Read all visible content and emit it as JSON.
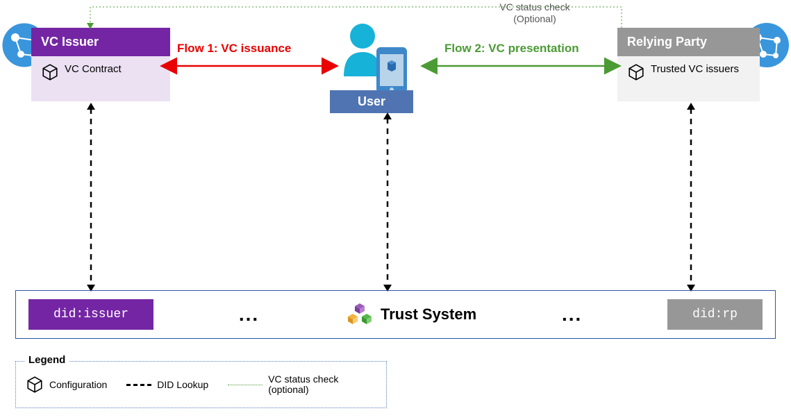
{
  "issuer": {
    "title": "VC Issuer",
    "contract": "VC Contract"
  },
  "rp": {
    "title": "Relying Party",
    "contract": "Trusted VC issuers"
  },
  "user": {
    "label": "User"
  },
  "flows": {
    "flow1": "Flow 1: VC  issuance",
    "flow2": "Flow 2: VC presentation"
  },
  "status_check": {
    "line1": "VC status check",
    "line2": "(Optional)"
  },
  "trust": {
    "did_issuer": "did:issuer",
    "did_rp": "did:rp",
    "title": "Trust System",
    "dots": "..."
  },
  "legend": {
    "title": "Legend",
    "config": "Configuration",
    "lookup": "DID Lookup",
    "status1": "VC status check",
    "status2": "(optional)"
  }
}
